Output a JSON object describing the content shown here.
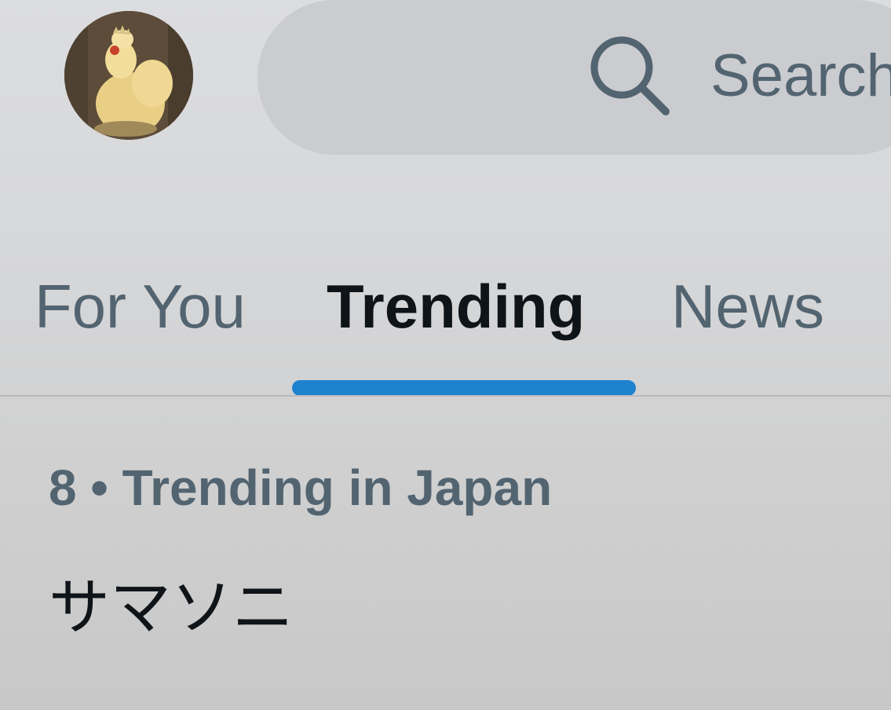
{
  "header": {
    "avatar_icon": "rooster-avatar-icon",
    "search": {
      "icon": "search-icon",
      "placeholder": "Search"
    }
  },
  "tabs": [
    {
      "label": "For You",
      "active": false
    },
    {
      "label": "Trending",
      "active": true
    },
    {
      "label": "News",
      "active": false
    }
  ],
  "trend": {
    "meta": "8 • Trending in Japan",
    "title": "サマソニ"
  },
  "colors": {
    "accent": "#1d82cf",
    "primary_text": "#0f1419",
    "secondary_text": "#536471"
  }
}
